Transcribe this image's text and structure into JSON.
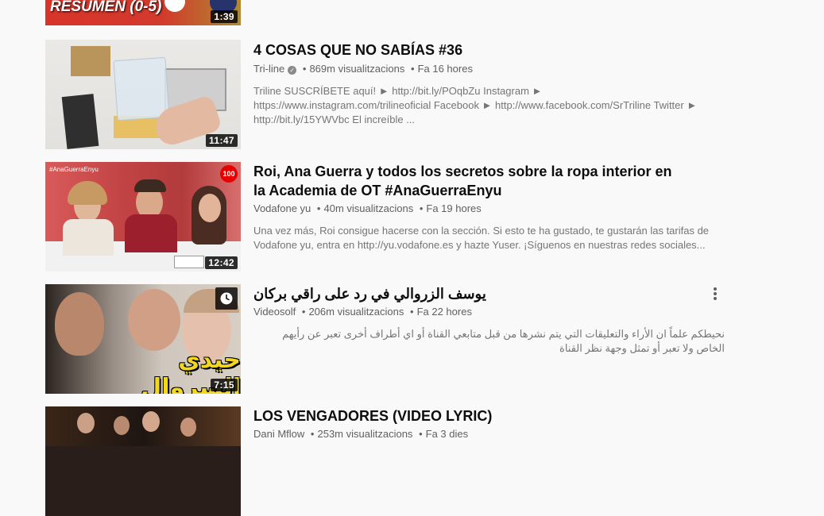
{
  "videos": [
    {
      "title": "",
      "thumb_text": "RESUMEN (0-5)",
      "duration": "1:39"
    },
    {
      "title": "4 COSAS QUE NO SABÍAS #36",
      "channel": "Tri-line",
      "verified": true,
      "views": "869m visualitzacions",
      "age": "Fa 16 hores",
      "description": "Triline SUSCRÍBETE aquí! ► http://bit.ly/POqbZu Instagram ► https://www.instagram.com/trilineoficial Facebook ► http://www.facebook.com/SrTriline Twitter ► http://bit.ly/15YWVbc El increíble ...",
      "duration": "11:47"
    },
    {
      "title": "Roi, Ana Guerra y todos los secretos sobre la ropa interior en la Academia de OT #AnaGuerraEnyu",
      "channel": "Vodafone yu",
      "views": "40m visualitzacions",
      "age": "Fa 19 hores",
      "description": "Una vez más, Roi consigue hacerse con la sección. Si esto te ha gustado, te gustarán las tarifas de Vodafone yu, entra en http://yu.vodafone.es y hazte Yuser. ¡Síguenos en nuestras redes sociales...",
      "duration": "12:42",
      "thumb_tag": "#AnaGuerraEnyu",
      "thumb_logo": "100"
    },
    {
      "title": "يوسف الزروالي في رد على راقي بركان",
      "channel": "Videosolf",
      "views": "206m visualitzacions",
      "age": "Fa 22 hores",
      "description": "نحيطكم علماً ان الأراء والتعليقات التي يتم نشرها من قبل متابعي القناة أو اي أطراف أخرى تعبر عن رأيهم الخاص ولا تعبر أو تمثل وجهة نظر القناة",
      "duration": "7:15",
      "thumb_text": "حيدي السروال"
    },
    {
      "title": "LOS VENGADORES (VIDEO LYRIC)",
      "channel": "Dani Mflow",
      "views": "253m visualitzacions",
      "age": "Fa 3 dies"
    }
  ],
  "meta_separator": "•",
  "icons": {
    "verified": "check-circle-icon",
    "menu": "more-vert-icon",
    "watch_later": "clock-icon"
  },
  "colors": {
    "background": "#f9f9f9",
    "title": "#0d0d0d",
    "meta": "#606060",
    "description": "#757575"
  }
}
